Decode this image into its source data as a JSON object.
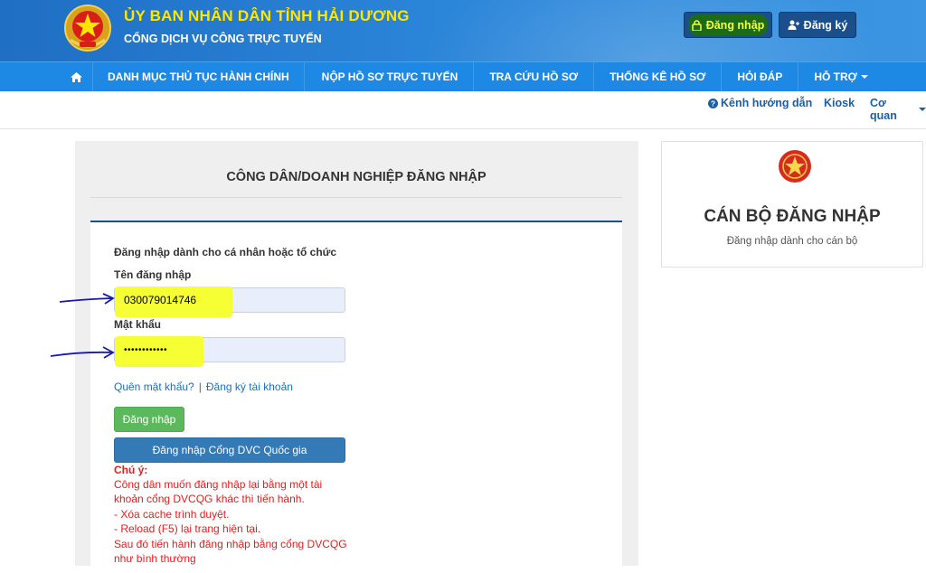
{
  "header": {
    "title_main": "ỦY BAN NHÂN DÂN TỈNH HẢI DƯƠNG",
    "title_sub": "CỔNG DỊCH VỤ CÔNG TRỰC TUYẾN",
    "login_label": "Đăng nhập",
    "register_label": "Đăng ký"
  },
  "nav": {
    "items": [
      {
        "label": "DANH MỤC THỦ TỤC HÀNH CHÍNH"
      },
      {
        "label": "NỘP HỒ SƠ TRỰC TUYẾN"
      },
      {
        "label": "TRA CỨU HỒ SƠ"
      },
      {
        "label": "THỐNG KÊ HỒ SƠ"
      },
      {
        "label": "HỎI ĐÁP"
      },
      {
        "label": "HỖ TRỢ"
      }
    ]
  },
  "subbar": {
    "guide_label": "Kênh hướng dẫn",
    "kiosk_label": "Kiosk",
    "agency_label": "Cơ quan"
  },
  "citizen_login": {
    "title": "CÔNG DÂN/DOANH NGHIỆP ĐĂNG NHẬP",
    "intro": "Đăng nhập dành cho cá nhân hoặc tổ chức",
    "username_label": "Tên đăng nhập",
    "username_value": "030079014746",
    "password_label": "Mật khẩu",
    "password_value": "••••••••••••",
    "forgot_label": "Quên mật khẩu?",
    "separator": "|",
    "register_label": "Đăng ký tài khoản",
    "login_button": "Đăng nhập",
    "national_login_button": "Đăng nhập Cổng DVC Quốc gia",
    "note_title": "Chú ý:",
    "note_lines": [
      "Công dân muốn đăng nhập lại bằng một tài",
      "khoản cổng DVCQG khác thì tiến hành.",
      "- Xóa cache trình duyệt.",
      "- Reload (F5) lại trang hiện tại.",
      "Sau đó tiến hành đăng nhập bằng cổng DVCQG",
      "như bình thường"
    ]
  },
  "official_login": {
    "title": "CÁN BỘ ĐĂNG NHẬP",
    "subtitle": "Đăng nhập dành cho cán bộ"
  },
  "colors": {
    "banner": "#2a84d8",
    "nav": "#1e88e5",
    "title_yellow": "#ffe600",
    "highlight": "#f6ff34",
    "note_red": "#e02020",
    "green_button": "#5cb85c",
    "blue_button": "#337ab7"
  }
}
